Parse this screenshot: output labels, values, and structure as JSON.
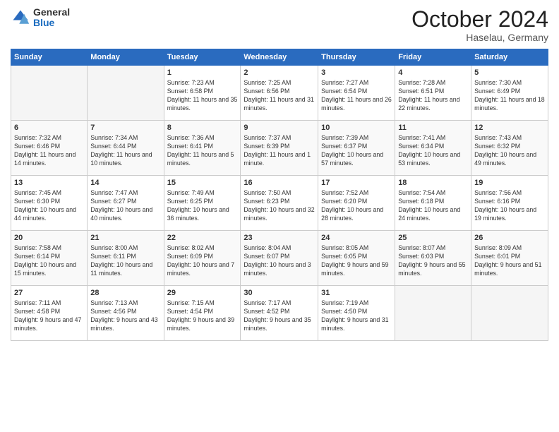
{
  "logo": {
    "general": "General",
    "blue": "Blue"
  },
  "header": {
    "month": "October 2024",
    "location": "Haselau, Germany"
  },
  "weekdays": [
    "Sunday",
    "Monday",
    "Tuesday",
    "Wednesday",
    "Thursday",
    "Friday",
    "Saturday"
  ],
  "weeks": [
    [
      {
        "day": "",
        "sunrise": "",
        "sunset": "",
        "daylight": "",
        "empty": true
      },
      {
        "day": "",
        "sunrise": "",
        "sunset": "",
        "daylight": "",
        "empty": true
      },
      {
        "day": "1",
        "sunrise": "Sunrise: 7:23 AM",
        "sunset": "Sunset: 6:58 PM",
        "daylight": "Daylight: 11 hours and 35 minutes.",
        "empty": false
      },
      {
        "day": "2",
        "sunrise": "Sunrise: 7:25 AM",
        "sunset": "Sunset: 6:56 PM",
        "daylight": "Daylight: 11 hours and 31 minutes.",
        "empty": false
      },
      {
        "day": "3",
        "sunrise": "Sunrise: 7:27 AM",
        "sunset": "Sunset: 6:54 PM",
        "daylight": "Daylight: 11 hours and 26 minutes.",
        "empty": false
      },
      {
        "day": "4",
        "sunrise": "Sunrise: 7:28 AM",
        "sunset": "Sunset: 6:51 PM",
        "daylight": "Daylight: 11 hours and 22 minutes.",
        "empty": false
      },
      {
        "day": "5",
        "sunrise": "Sunrise: 7:30 AM",
        "sunset": "Sunset: 6:49 PM",
        "daylight": "Daylight: 11 hours and 18 minutes.",
        "empty": false
      }
    ],
    [
      {
        "day": "6",
        "sunrise": "Sunrise: 7:32 AM",
        "sunset": "Sunset: 6:46 PM",
        "daylight": "Daylight: 11 hours and 14 minutes.",
        "empty": false
      },
      {
        "day": "7",
        "sunrise": "Sunrise: 7:34 AM",
        "sunset": "Sunset: 6:44 PM",
        "daylight": "Daylight: 11 hours and 10 minutes.",
        "empty": false
      },
      {
        "day": "8",
        "sunrise": "Sunrise: 7:36 AM",
        "sunset": "Sunset: 6:41 PM",
        "daylight": "Daylight: 11 hours and 5 minutes.",
        "empty": false
      },
      {
        "day": "9",
        "sunrise": "Sunrise: 7:37 AM",
        "sunset": "Sunset: 6:39 PM",
        "daylight": "Daylight: 11 hours and 1 minute.",
        "empty": false
      },
      {
        "day": "10",
        "sunrise": "Sunrise: 7:39 AM",
        "sunset": "Sunset: 6:37 PM",
        "daylight": "Daylight: 10 hours and 57 minutes.",
        "empty": false
      },
      {
        "day": "11",
        "sunrise": "Sunrise: 7:41 AM",
        "sunset": "Sunset: 6:34 PM",
        "daylight": "Daylight: 10 hours and 53 minutes.",
        "empty": false
      },
      {
        "day": "12",
        "sunrise": "Sunrise: 7:43 AM",
        "sunset": "Sunset: 6:32 PM",
        "daylight": "Daylight: 10 hours and 49 minutes.",
        "empty": false
      }
    ],
    [
      {
        "day": "13",
        "sunrise": "Sunrise: 7:45 AM",
        "sunset": "Sunset: 6:30 PM",
        "daylight": "Daylight: 10 hours and 44 minutes.",
        "empty": false
      },
      {
        "day": "14",
        "sunrise": "Sunrise: 7:47 AM",
        "sunset": "Sunset: 6:27 PM",
        "daylight": "Daylight: 10 hours and 40 minutes.",
        "empty": false
      },
      {
        "day": "15",
        "sunrise": "Sunrise: 7:49 AM",
        "sunset": "Sunset: 6:25 PM",
        "daylight": "Daylight: 10 hours and 36 minutes.",
        "empty": false
      },
      {
        "day": "16",
        "sunrise": "Sunrise: 7:50 AM",
        "sunset": "Sunset: 6:23 PM",
        "daylight": "Daylight: 10 hours and 32 minutes.",
        "empty": false
      },
      {
        "day": "17",
        "sunrise": "Sunrise: 7:52 AM",
        "sunset": "Sunset: 6:20 PM",
        "daylight": "Daylight: 10 hours and 28 minutes.",
        "empty": false
      },
      {
        "day": "18",
        "sunrise": "Sunrise: 7:54 AM",
        "sunset": "Sunset: 6:18 PM",
        "daylight": "Daylight: 10 hours and 24 minutes.",
        "empty": false
      },
      {
        "day": "19",
        "sunrise": "Sunrise: 7:56 AM",
        "sunset": "Sunset: 6:16 PM",
        "daylight": "Daylight: 10 hours and 19 minutes.",
        "empty": false
      }
    ],
    [
      {
        "day": "20",
        "sunrise": "Sunrise: 7:58 AM",
        "sunset": "Sunset: 6:14 PM",
        "daylight": "Daylight: 10 hours and 15 minutes.",
        "empty": false
      },
      {
        "day": "21",
        "sunrise": "Sunrise: 8:00 AM",
        "sunset": "Sunset: 6:11 PM",
        "daylight": "Daylight: 10 hours and 11 minutes.",
        "empty": false
      },
      {
        "day": "22",
        "sunrise": "Sunrise: 8:02 AM",
        "sunset": "Sunset: 6:09 PM",
        "daylight": "Daylight: 10 hours and 7 minutes.",
        "empty": false
      },
      {
        "day": "23",
        "sunrise": "Sunrise: 8:04 AM",
        "sunset": "Sunset: 6:07 PM",
        "daylight": "Daylight: 10 hours and 3 minutes.",
        "empty": false
      },
      {
        "day": "24",
        "sunrise": "Sunrise: 8:05 AM",
        "sunset": "Sunset: 6:05 PM",
        "daylight": "Daylight: 9 hours and 59 minutes.",
        "empty": false
      },
      {
        "day": "25",
        "sunrise": "Sunrise: 8:07 AM",
        "sunset": "Sunset: 6:03 PM",
        "daylight": "Daylight: 9 hours and 55 minutes.",
        "empty": false
      },
      {
        "day": "26",
        "sunrise": "Sunrise: 8:09 AM",
        "sunset": "Sunset: 6:01 PM",
        "daylight": "Daylight: 9 hours and 51 minutes.",
        "empty": false
      }
    ],
    [
      {
        "day": "27",
        "sunrise": "Sunrise: 7:11 AM",
        "sunset": "Sunset: 4:58 PM",
        "daylight": "Daylight: 9 hours and 47 minutes.",
        "empty": false
      },
      {
        "day": "28",
        "sunrise": "Sunrise: 7:13 AM",
        "sunset": "Sunset: 4:56 PM",
        "daylight": "Daylight: 9 hours and 43 minutes.",
        "empty": false
      },
      {
        "day": "29",
        "sunrise": "Sunrise: 7:15 AM",
        "sunset": "Sunset: 4:54 PM",
        "daylight": "Daylight: 9 hours and 39 minutes.",
        "empty": false
      },
      {
        "day": "30",
        "sunrise": "Sunrise: 7:17 AM",
        "sunset": "Sunset: 4:52 PM",
        "daylight": "Daylight: 9 hours and 35 minutes.",
        "empty": false
      },
      {
        "day": "31",
        "sunrise": "Sunrise: 7:19 AM",
        "sunset": "Sunset: 4:50 PM",
        "daylight": "Daylight: 9 hours and 31 minutes.",
        "empty": false
      },
      {
        "day": "",
        "sunrise": "",
        "sunset": "",
        "daylight": "",
        "empty": true
      },
      {
        "day": "",
        "sunrise": "",
        "sunset": "",
        "daylight": "",
        "empty": true
      }
    ]
  ]
}
